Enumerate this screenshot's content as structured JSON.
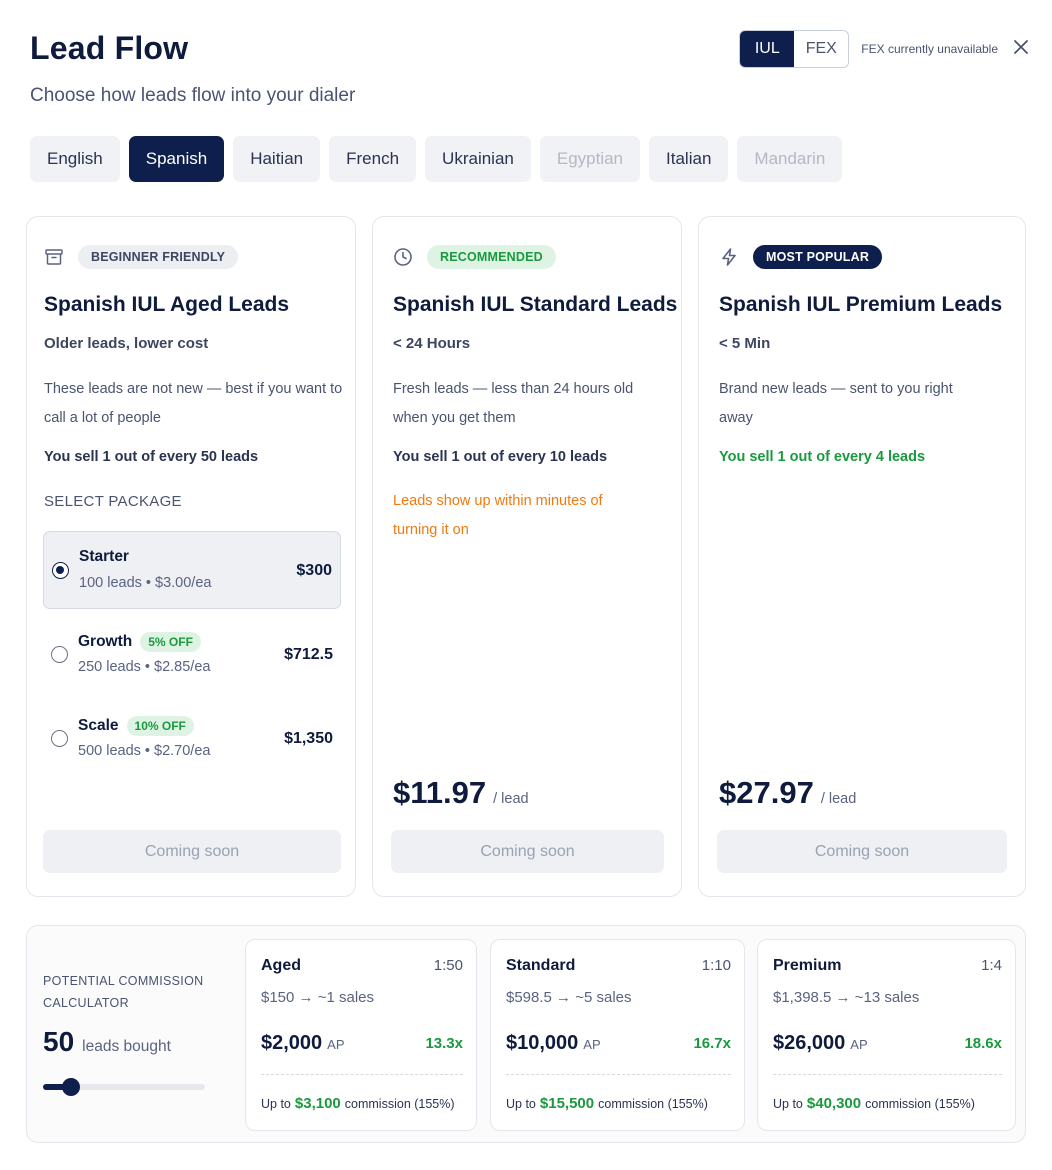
{
  "header": {
    "title": "Lead Flow",
    "subtitle": "Choose how leads flow into your dialer"
  },
  "product_toggle": {
    "options": [
      "IUL",
      "FEX"
    ],
    "selected": "IUL",
    "note": "FEX currently unavailable",
    "close_icon": "close-icon"
  },
  "languages": [
    {
      "label": "English",
      "state": "default"
    },
    {
      "label": "Spanish",
      "state": "active"
    },
    {
      "label": "Haitian",
      "state": "default"
    },
    {
      "label": "French",
      "state": "default"
    },
    {
      "label": "Ukrainian",
      "state": "default"
    },
    {
      "label": "Egyptian",
      "state": "disabled"
    },
    {
      "label": "Italian",
      "state": "default"
    },
    {
      "label": "Mandarin",
      "state": "disabled"
    }
  ],
  "cards": [
    {
      "icon": "archive-box-icon",
      "badge": "BEGINNER FRIENDLY",
      "title": "Spanish IUL Aged Leads",
      "subtitle": "Older leads, lower cost",
      "description": "These leads are not new — best if you want to call a lot of people",
      "sell": "You sell 1 out of every 50 leads",
      "package_label": "SELECT PACKAGE",
      "packages": [
        {
          "name": "Starter",
          "discount": "",
          "detail": "100 leads • $3.00/ea",
          "price": "$300",
          "selected": true
        },
        {
          "name": "Growth",
          "discount": "5% OFF",
          "detail": "250 leads • $2.85/ea",
          "price": "$712.5",
          "selected": false
        },
        {
          "name": "Scale",
          "discount": "10% OFF",
          "detail": "500 leads • $2.70/ea",
          "price": "$1,350",
          "selected": false
        }
      ],
      "button": "Coming soon"
    },
    {
      "icon": "clock-icon",
      "badge": "RECOMMENDED",
      "title": "Spanish IUL Standard Leads",
      "subtitle": "< 24 Hours",
      "description": "Fresh leads — less than 24 hours old when you get them",
      "sell": "You sell 1 out of every 10 leads",
      "note": "Leads show up within minutes of turning it on",
      "price": "$11.97",
      "price_unit": "/ lead",
      "button": "Coming soon"
    },
    {
      "icon": "lightning-bolt-icon",
      "badge": "MOST POPULAR",
      "title": "Spanish IUL Premium Leads",
      "subtitle": "< 5 Min",
      "description": "Brand new leads — sent to you right away",
      "sell": "You sell 1 out of every 4 leads",
      "price": "$27.97",
      "price_unit": "/ lead",
      "button": "Coming soon"
    }
  ],
  "calculator": {
    "label": "POTENTIAL COMMISSION CALCULATOR",
    "leads_count": "50",
    "leads_text": "leads bought",
    "slider_fraction": 0.17,
    "tiers": [
      {
        "name": "Aged",
        "ratio": "1:50",
        "cost": "$150 → ~1 sales",
        "ap": "$2,000",
        "ap_label": "AP",
        "multiple": "13.3x",
        "foot_prefix": "Up to",
        "commission": "$3,100",
        "foot_suffix": "commission (155%)"
      },
      {
        "name": "Standard",
        "ratio": "1:10",
        "cost": "$598.5 → ~5 sales",
        "ap": "$10,000",
        "ap_label": "AP",
        "multiple": "16.7x",
        "foot_prefix": "Up to",
        "commission": "$15,500",
        "foot_suffix": "commission (155%)"
      },
      {
        "name": "Premium",
        "ratio": "1:4",
        "cost": "$1,398.5 → ~13 sales",
        "ap": "$26,000",
        "ap_label": "AP",
        "multiple": "18.6x",
        "foot_prefix": "Up to",
        "commission": "$40,300",
        "foot_suffix": "commission (155%)"
      }
    ]
  },
  "colors": {
    "navy": "#0f1f4d",
    "green": "#1a9a3e",
    "orange": "#f07a10"
  }
}
